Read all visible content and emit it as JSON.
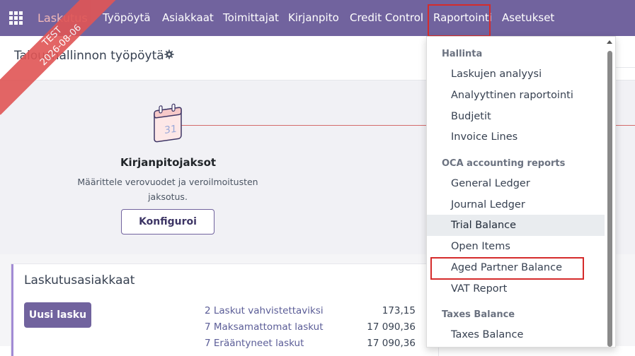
{
  "navbar": {
    "brand": "Laskutus",
    "items": [
      "Työpöytä",
      "Asiakkaat",
      "Toimittajat",
      "Kirjanpito",
      "Credit Control",
      "Raportointi",
      "Asetukset"
    ]
  },
  "ribbon": {
    "line1": "TEST",
    "line2": "2026-08-06"
  },
  "page": {
    "title": "Taloushallinnon työpöytä"
  },
  "onboarding": {
    "title": "Kirjanpitojaksot",
    "description_line1": "Määrittele verovuodet ja veroilmoitusten",
    "description_line2": "jaksotus.",
    "button": "Konfiguroi",
    "calendar_day": "31"
  },
  "card": {
    "title": "Laskutusasiakkaat",
    "new_button": "Uusi lasku",
    "stats": [
      {
        "label": "2 Laskut vahvistettaviksi",
        "value": "173,15"
      },
      {
        "label": "7 Maksamattomat laskut",
        "value": "17 090,36"
      },
      {
        "label": "7 Erääntyneet laskut",
        "value": "17 090,36"
      }
    ]
  },
  "reporting_menu": {
    "sections": [
      {
        "header": "Hallinta",
        "items": [
          "Laskujen analyysi",
          "Analyyttinen raportointi",
          "Budjetit",
          "Invoice Lines"
        ]
      },
      {
        "header": "OCA accounting reports",
        "items": [
          "General Ledger",
          "Journal Ledger",
          "Trial Balance",
          "Open Items",
          "Aged Partner Balance",
          "VAT Report"
        ]
      },
      {
        "header": "Taxes Balance",
        "items": [
          "Taxes Balance"
        ]
      }
    ],
    "hovered_item": "Trial Balance",
    "highlighted_item": "Aged Partner Balance"
  },
  "colors": {
    "navbar": "#71639e",
    "accent": "#71639e",
    "highlight_border": "#d52b2b",
    "ribbon": "#e05555"
  }
}
